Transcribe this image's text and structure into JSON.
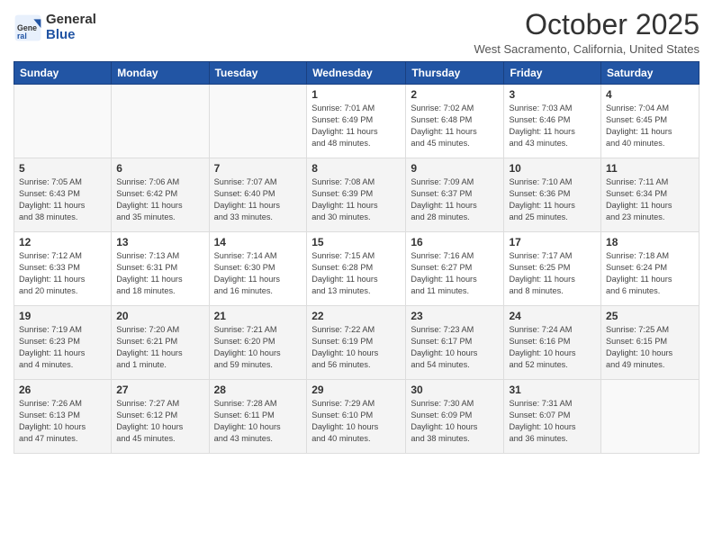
{
  "logo": {
    "general": "General",
    "blue": "Blue"
  },
  "title": "October 2025",
  "subtitle": "West Sacramento, California, United States",
  "days_of_week": [
    "Sunday",
    "Monday",
    "Tuesday",
    "Wednesday",
    "Thursday",
    "Friday",
    "Saturday"
  ],
  "weeks": [
    [
      {
        "day": "",
        "info": ""
      },
      {
        "day": "",
        "info": ""
      },
      {
        "day": "",
        "info": ""
      },
      {
        "day": "1",
        "info": "Sunrise: 7:01 AM\nSunset: 6:49 PM\nDaylight: 11 hours\nand 48 minutes."
      },
      {
        "day": "2",
        "info": "Sunrise: 7:02 AM\nSunset: 6:48 PM\nDaylight: 11 hours\nand 45 minutes."
      },
      {
        "day": "3",
        "info": "Sunrise: 7:03 AM\nSunset: 6:46 PM\nDaylight: 11 hours\nand 43 minutes."
      },
      {
        "day": "4",
        "info": "Sunrise: 7:04 AM\nSunset: 6:45 PM\nDaylight: 11 hours\nand 40 minutes."
      }
    ],
    [
      {
        "day": "5",
        "info": "Sunrise: 7:05 AM\nSunset: 6:43 PM\nDaylight: 11 hours\nand 38 minutes."
      },
      {
        "day": "6",
        "info": "Sunrise: 7:06 AM\nSunset: 6:42 PM\nDaylight: 11 hours\nand 35 minutes."
      },
      {
        "day": "7",
        "info": "Sunrise: 7:07 AM\nSunset: 6:40 PM\nDaylight: 11 hours\nand 33 minutes."
      },
      {
        "day": "8",
        "info": "Sunrise: 7:08 AM\nSunset: 6:39 PM\nDaylight: 11 hours\nand 30 minutes."
      },
      {
        "day": "9",
        "info": "Sunrise: 7:09 AM\nSunset: 6:37 PM\nDaylight: 11 hours\nand 28 minutes."
      },
      {
        "day": "10",
        "info": "Sunrise: 7:10 AM\nSunset: 6:36 PM\nDaylight: 11 hours\nand 25 minutes."
      },
      {
        "day": "11",
        "info": "Sunrise: 7:11 AM\nSunset: 6:34 PM\nDaylight: 11 hours\nand 23 minutes."
      }
    ],
    [
      {
        "day": "12",
        "info": "Sunrise: 7:12 AM\nSunset: 6:33 PM\nDaylight: 11 hours\nand 20 minutes."
      },
      {
        "day": "13",
        "info": "Sunrise: 7:13 AM\nSunset: 6:31 PM\nDaylight: 11 hours\nand 18 minutes."
      },
      {
        "day": "14",
        "info": "Sunrise: 7:14 AM\nSunset: 6:30 PM\nDaylight: 11 hours\nand 16 minutes."
      },
      {
        "day": "15",
        "info": "Sunrise: 7:15 AM\nSunset: 6:28 PM\nDaylight: 11 hours\nand 13 minutes."
      },
      {
        "day": "16",
        "info": "Sunrise: 7:16 AM\nSunset: 6:27 PM\nDaylight: 11 hours\nand 11 minutes."
      },
      {
        "day": "17",
        "info": "Sunrise: 7:17 AM\nSunset: 6:25 PM\nDaylight: 11 hours\nand 8 minutes."
      },
      {
        "day": "18",
        "info": "Sunrise: 7:18 AM\nSunset: 6:24 PM\nDaylight: 11 hours\nand 6 minutes."
      }
    ],
    [
      {
        "day": "19",
        "info": "Sunrise: 7:19 AM\nSunset: 6:23 PM\nDaylight: 11 hours\nand 4 minutes."
      },
      {
        "day": "20",
        "info": "Sunrise: 7:20 AM\nSunset: 6:21 PM\nDaylight: 11 hours\nand 1 minute."
      },
      {
        "day": "21",
        "info": "Sunrise: 7:21 AM\nSunset: 6:20 PM\nDaylight: 10 hours\nand 59 minutes."
      },
      {
        "day": "22",
        "info": "Sunrise: 7:22 AM\nSunset: 6:19 PM\nDaylight: 10 hours\nand 56 minutes."
      },
      {
        "day": "23",
        "info": "Sunrise: 7:23 AM\nSunset: 6:17 PM\nDaylight: 10 hours\nand 54 minutes."
      },
      {
        "day": "24",
        "info": "Sunrise: 7:24 AM\nSunset: 6:16 PM\nDaylight: 10 hours\nand 52 minutes."
      },
      {
        "day": "25",
        "info": "Sunrise: 7:25 AM\nSunset: 6:15 PM\nDaylight: 10 hours\nand 49 minutes."
      }
    ],
    [
      {
        "day": "26",
        "info": "Sunrise: 7:26 AM\nSunset: 6:13 PM\nDaylight: 10 hours\nand 47 minutes."
      },
      {
        "day": "27",
        "info": "Sunrise: 7:27 AM\nSunset: 6:12 PM\nDaylight: 10 hours\nand 45 minutes."
      },
      {
        "day": "28",
        "info": "Sunrise: 7:28 AM\nSunset: 6:11 PM\nDaylight: 10 hours\nand 43 minutes."
      },
      {
        "day": "29",
        "info": "Sunrise: 7:29 AM\nSunset: 6:10 PM\nDaylight: 10 hours\nand 40 minutes."
      },
      {
        "day": "30",
        "info": "Sunrise: 7:30 AM\nSunset: 6:09 PM\nDaylight: 10 hours\nand 38 minutes."
      },
      {
        "day": "31",
        "info": "Sunrise: 7:31 AM\nSunset: 6:07 PM\nDaylight: 10 hours\nand 36 minutes."
      },
      {
        "day": "",
        "info": ""
      }
    ]
  ]
}
